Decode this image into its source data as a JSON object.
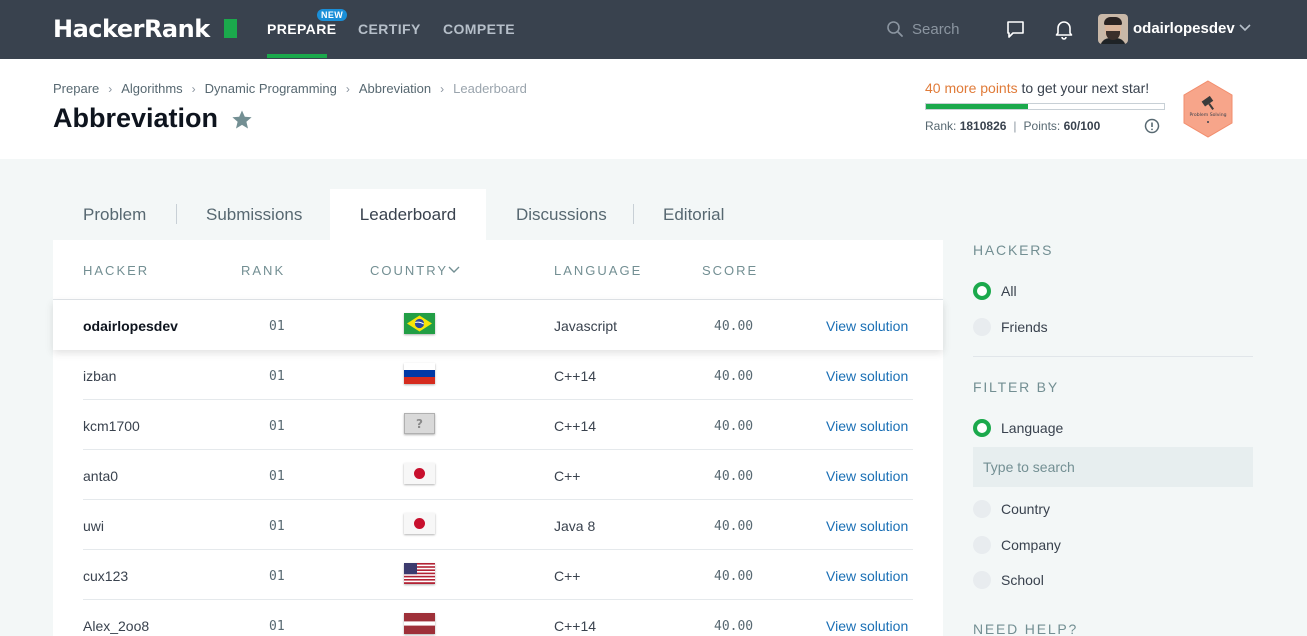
{
  "nav": {
    "logo": "HackerRank",
    "items": [
      {
        "label": "PREPARE",
        "active": true,
        "badge": "NEW"
      },
      {
        "label": "CERTIFY"
      },
      {
        "label": "COMPETE"
      }
    ],
    "search_placeholder": "Search",
    "username": "odairlopesdev"
  },
  "breadcrumb": [
    "Prepare",
    "Algorithms",
    "Dynamic Programming",
    "Abbreviation",
    "Leaderboard"
  ],
  "title": "Abbreviation",
  "progress": {
    "points_highlight": "40 more points",
    "points_rest": " to get your next star!",
    "fill_fraction": 0.43,
    "rank_label": "Rank:",
    "rank_value": "1810826",
    "points_label": "Points:",
    "points_value": "60/100",
    "badge_text": "Problem Solving"
  },
  "tabs": [
    "Problem",
    "Submissions",
    "Leaderboard",
    "Discussions",
    "Editorial"
  ],
  "table": {
    "headers": {
      "hacker": "HACKER",
      "rank": "RANK",
      "country": "COUNTRY",
      "language": "LANGUAGE",
      "score": "SCORE"
    },
    "rows": [
      {
        "hacker": "odairlopesdev",
        "rank": "01",
        "country": "Brazil",
        "language": "Javascript",
        "score": "40.00",
        "action": "View solution"
      },
      {
        "hacker": "izban",
        "rank": "01",
        "country": "Russia",
        "language": "C++14",
        "score": "40.00",
        "action": "View solution"
      },
      {
        "hacker": "kcm1700",
        "rank": "01",
        "country": "Unknown",
        "language": "C++14",
        "score": "40.00",
        "action": "View solution"
      },
      {
        "hacker": "anta0",
        "rank": "01",
        "country": "Japan",
        "language": "C++",
        "score": "40.00",
        "action": "View solution"
      },
      {
        "hacker": "uwi",
        "rank": "01",
        "country": "Japan",
        "language": "Java 8",
        "score": "40.00",
        "action": "View solution"
      },
      {
        "hacker": "cux123",
        "rank": "01",
        "country": "United States",
        "language": "C++",
        "score": "40.00",
        "action": "View solution"
      },
      {
        "hacker": "Alex_2oo8",
        "rank": "01",
        "country": "Latvia",
        "language": "C++14",
        "score": "40.00",
        "action": "View solution"
      }
    ]
  },
  "sidebar": {
    "hackers_heading": "HACKERS",
    "hackers_options": [
      {
        "label": "All",
        "selected": true
      },
      {
        "label": "Friends",
        "selected": false
      }
    ],
    "filter_heading": "FILTER BY",
    "filter_options": [
      {
        "label": "Language",
        "selected": true
      },
      {
        "label": "Country",
        "selected": false
      },
      {
        "label": "Company",
        "selected": false
      },
      {
        "label": "School",
        "selected": false
      }
    ],
    "language_search_placeholder": "Type to search",
    "help_heading": "NEED HELP?"
  },
  "colors": {
    "nav_bg": "#39424e",
    "accent_green": "#1ba94c",
    "link_blue": "#1a6fb5",
    "new_badge": "#1a8fd8",
    "points_orange": "#e07b39"
  }
}
